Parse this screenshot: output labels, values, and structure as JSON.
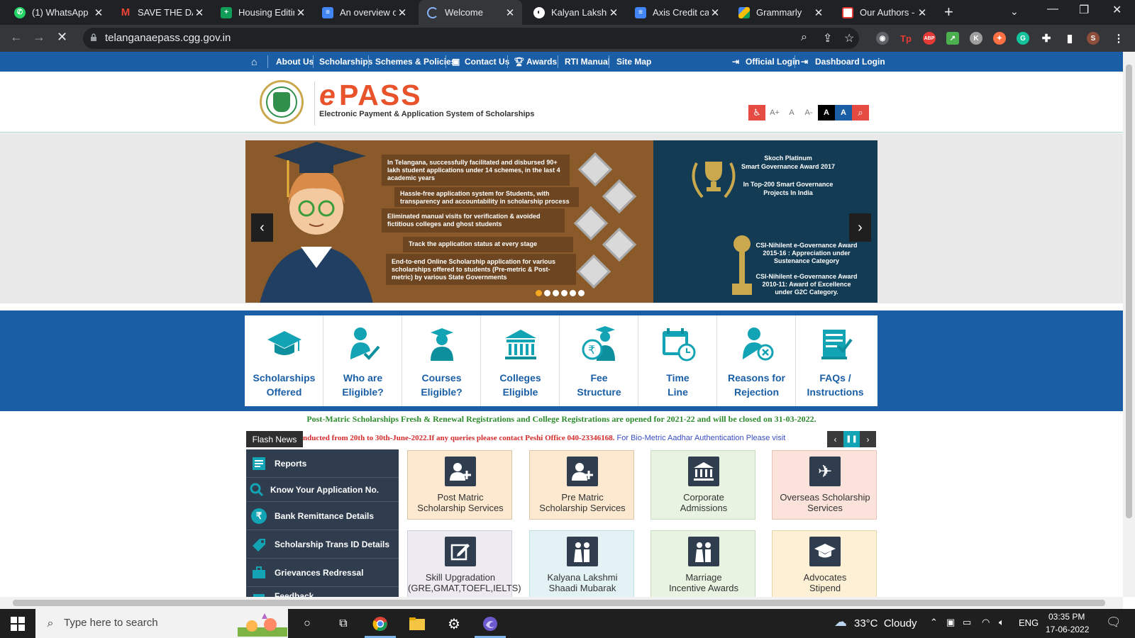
{
  "browser": {
    "tabs": [
      {
        "title": "(1) WhatsApp",
        "favicon": "whatsapp-icon",
        "color": "#25d366"
      },
      {
        "title": "SAVE THE DAT",
        "favicon": "gmail-icon",
        "color": "#ea4335"
      },
      {
        "title": "Housing Editin",
        "favicon": "sheets-icon",
        "color": "#0f9d58"
      },
      {
        "title": "An overview o",
        "favicon": "docs-icon",
        "color": "#4285f4"
      },
      {
        "title": "Welcome",
        "favicon": "loading-icon",
        "color": "#8ab4f8",
        "active": true
      },
      {
        "title": "Kalyan Lakshm",
        "favicon": "globe-icon",
        "color": "#ffffff"
      },
      {
        "title": "Axis Credit ca",
        "favicon": "docs-icon",
        "color": "#4285f4"
      },
      {
        "title": "Grammarly",
        "favicon": "drive-icon",
        "color": "#fbbc04"
      },
      {
        "title": "Our Authors -",
        "favicon": "authors-icon",
        "color": "#e53935"
      }
    ],
    "url": "telanganaepass.cgg.gov.in"
  },
  "topnav": {
    "items": [
      "About Us",
      "Scholarships",
      "Schemes & Policies",
      "Contact Us",
      "Awards",
      "RTI Manual",
      "Site Map"
    ],
    "official_login": "Official Login",
    "dashboard_login": "Dashboard Login"
  },
  "header": {
    "logo_e": "e",
    "logo_pass": "PASS",
    "tagline": "Electronic Payment & Application System of Scholarships",
    "accessibility": [
      "A+",
      "A",
      "A-",
      "A",
      "A"
    ]
  },
  "slider": {
    "points": [
      "In Telangana, successfully facilitated and disbursed 90+ lakh student applications under 14 schemes, in the last 4 academic years",
      "Hassle-free application system for Students, with transparency and accountability in scholarship process",
      "Eliminated manual visits for verification & avoided fictitious colleges and ghost students",
      "Track the application status at every stage",
      "End-to-end Online Scholarship application for various scholarships offered to students (Pre-metric & Post-metric) by various State Governments"
    ],
    "award1_line1": "Skoch Platinum",
    "award1_line2": "Smart Governance Award 2017",
    "award1_line3": "In Top-200 Smart Governance",
    "award1_line4": "Projects In India",
    "award2_text": "CSI-Nihilent e-Governance Award 2015-16 : Appreciation under Sustenance Category",
    "award3_text": "CSI-Nihilent e-Governance Award 2010-11: Award of Excellence under G2C Category.",
    "slide_count": 6,
    "active_slide": 1
  },
  "categories": [
    {
      "line1": "Scholarships",
      "line2": "Offered"
    },
    {
      "line1": "Who are",
      "line2": "Eligible?"
    },
    {
      "line1": "Courses",
      "line2": "Eligible?"
    },
    {
      "line1": "Colleges",
      "line2": "Eligible"
    },
    {
      "line1": "Fee",
      "line2": "Structure"
    },
    {
      "line1": "Time",
      "line2": "Line"
    },
    {
      "line1": "Reasons for",
      "line2": "Rejection"
    },
    {
      "line1": "FAQs /",
      "line2": "Instructions"
    }
  ],
  "notice": "Post-Matric Scholarships Fresh & Renewal Registrations and College Registrations are opened for 2021-22 and will be closed on 31-03-2022.",
  "flash": {
    "label": "Flash News",
    "red_text": "nducted from 20th to 30th-June-2022.If any queries please contact Peshi Office 040-23346168.",
    "blue_text": " For Bio-Metric Aadhar Authentication Please visit"
  },
  "sidebar": {
    "items": [
      "Reports",
      "Know Your Application No.",
      "Bank Remittance Details",
      "Scholarship Trans ID Details",
      "Grievances Redressal",
      "Feedback"
    ]
  },
  "services": [
    {
      "line1": "Post Matric",
      "line2": "Scholarship Services",
      "bg": "#fde9d0"
    },
    {
      "line1": "Pre Matric",
      "line2": "Scholarship Services",
      "bg": "#fde9d0"
    },
    {
      "line1": "Corporate",
      "line2": "Admissions",
      "bg": "#e8f3e2"
    },
    {
      "line1": "Overseas Scholarship",
      "line2": "Services",
      "bg": "#fbe3dc"
    },
    {
      "line1": "Skill Upgradation",
      "line2": "(GRE,GMAT,TOEFL,IELTS)",
      "bg": "#eeeaf2"
    },
    {
      "line1": "Kalyana Lakshmi",
      "line2": "Shaadi Mubarak",
      "bg": "#e3f2f4"
    },
    {
      "line1": "Marriage",
      "line2": "Incentive Awards",
      "bg": "#e8f3e2"
    },
    {
      "line1": "Advocates",
      "line2": "Stipend",
      "bg": "#fdf0d5"
    }
  ],
  "taskbar": {
    "search_placeholder": "Type here to search",
    "weather": "33°C  Cloudy",
    "language": "ENG",
    "time": "03:35 PM",
    "date": "17-06-2022"
  }
}
